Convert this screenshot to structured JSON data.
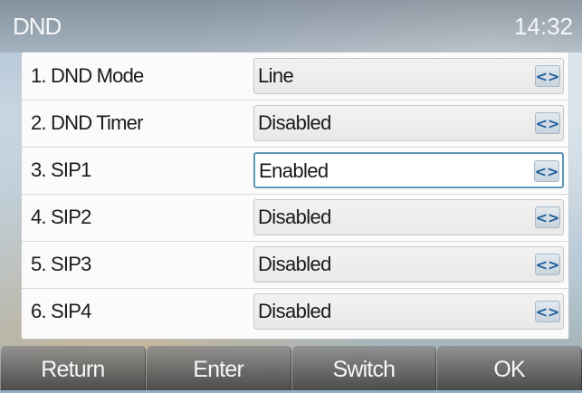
{
  "header": {
    "title": "DND",
    "time": "14:32"
  },
  "rows": [
    {
      "label": "1.  DND Mode",
      "value": "Line",
      "selected": false
    },
    {
      "label": "2.  DND Timer",
      "value": "Disabled",
      "selected": false
    },
    {
      "label": "3.  SIP1",
      "value": "Enabled",
      "selected": true
    },
    {
      "label": "4.  SIP2",
      "value": "Disabled",
      "selected": false
    },
    {
      "label": "5.  SIP3",
      "value": "Disabled",
      "selected": false
    },
    {
      "label": "6.  SIP4",
      "value": "Disabled",
      "selected": false
    }
  ],
  "arrow_icon": "<>",
  "softkeys": [
    "Return",
    "Enter",
    "Switch",
    "OK"
  ],
  "colors": {
    "selected_border": "#5f95b6",
    "arrow": "#1f5d9a"
  }
}
